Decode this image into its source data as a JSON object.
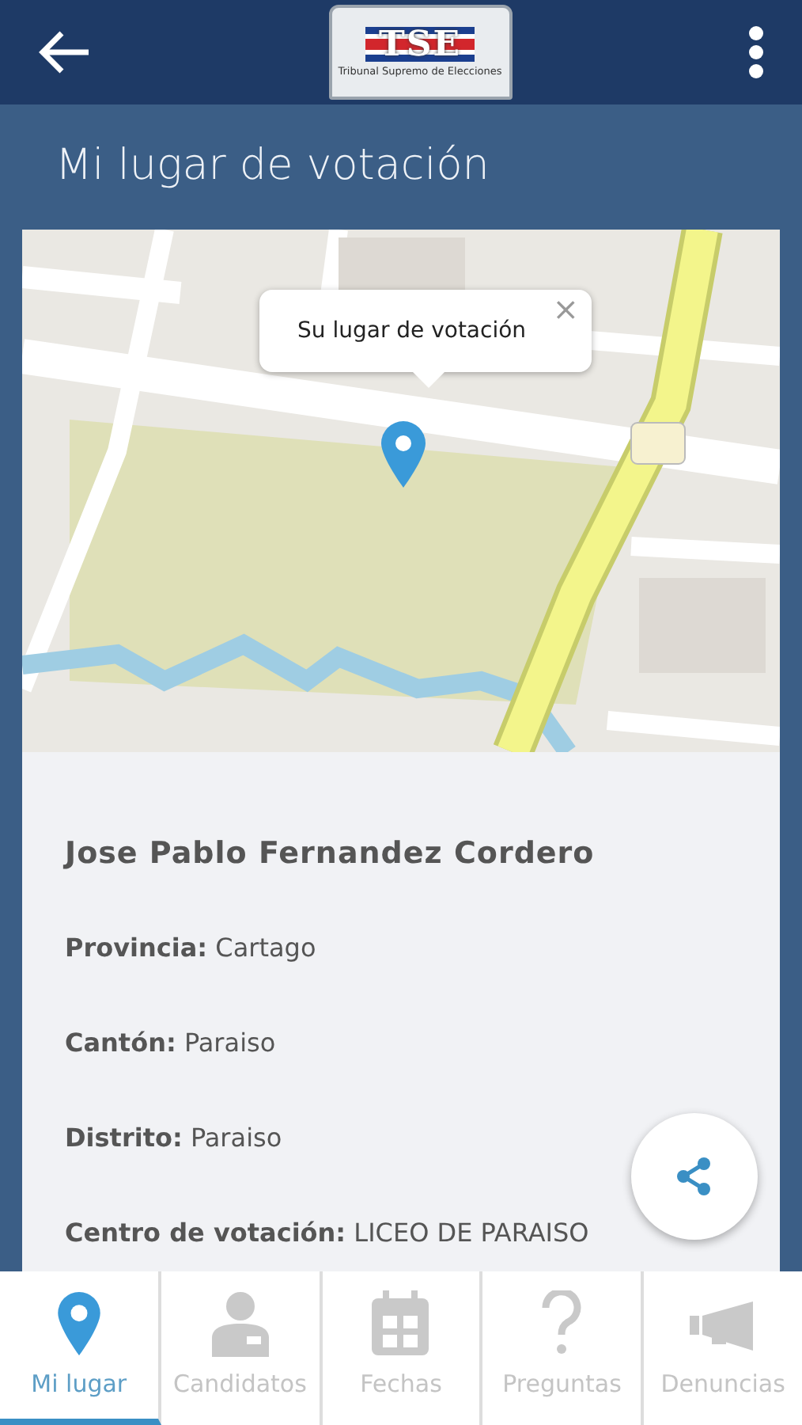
{
  "app_bar": {
    "logo_text": "TSE",
    "logo_subtitle": "Tribunal Supremo de Elecciones"
  },
  "page_title": "Mi lugar de votación",
  "map": {
    "kind": "picture",
    "popup": {
      "text": "Su lugar de votación",
      "close": "×"
    }
  },
  "voter": {
    "name": "Jose Pablo Fernandez Cordero",
    "fields": [
      {
        "label": "Provincia:",
        "value": "Cartago"
      },
      {
        "label": "Cantón:",
        "value": "Paraiso"
      },
      {
        "label": "Distrito:",
        "value": "Paraiso"
      },
      {
        "label": "Centro de votación:",
        "value": "LICEO DE PARAISO"
      }
    ]
  },
  "tabs": [
    {
      "label": "Mi lugar",
      "kind": "pin",
      "selected": true
    },
    {
      "label": "Candidatos",
      "kind": "person",
      "selected": false
    },
    {
      "label": "Fechas",
      "kind": "calendar",
      "selected": false
    },
    {
      "label": "Preguntas",
      "kind": "question",
      "selected": false
    },
    {
      "label": "Denuncias",
      "kind": "megaphone",
      "selected": false
    }
  ]
}
